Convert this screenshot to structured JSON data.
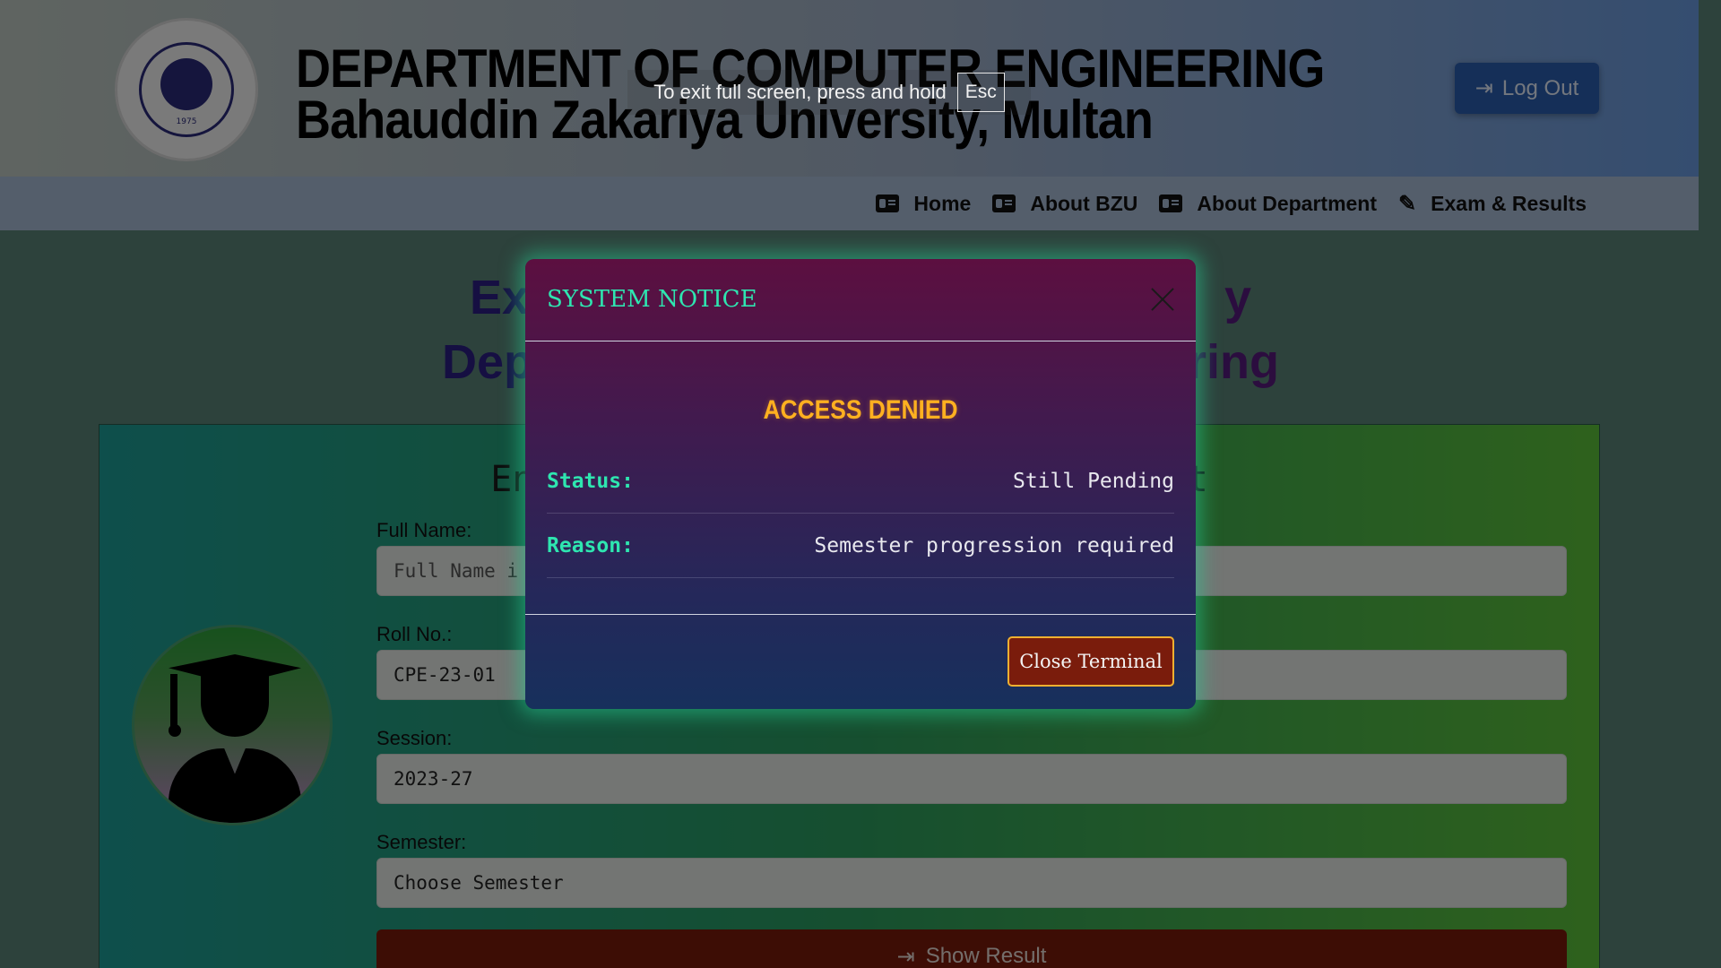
{
  "header": {
    "logo_text": "BAHAUDDIN ZAKARIYA UNIVERSITY MULTAN",
    "logo_year": "1975",
    "title_line1": "DEPARTMENT OF COMPUTER ENGINEERING",
    "title_line2": "Bahauddin Zakariya University, Multan",
    "logout_label": "Log Out"
  },
  "nav": {
    "items": [
      {
        "label": "Home",
        "icon": "id-card-icon"
      },
      {
        "label": "About BZU",
        "icon": "id-card-icon"
      },
      {
        "label": "About Department",
        "icon": "id-card-icon"
      },
      {
        "label": "Exam & Results",
        "icon": "pen-icon"
      }
    ]
  },
  "fullscreen_notice": {
    "text": "To exit full screen, press and hold",
    "key": "Esc"
  },
  "page": {
    "title_line1_left": "Ex",
    "title_line1_right": "y",
    "title_line2_left": "Depa",
    "title_line2_right": "ring",
    "panel_heading_left": "Ent",
    "panel_heading_right": "lt"
  },
  "form": {
    "full_name_label": "Full Name:",
    "full_name_placeholder": "Full Name i",
    "roll_label": "Roll No.:",
    "roll_value": "CPE-23-01",
    "session_label": "Session:",
    "session_value": "2023-27",
    "semester_label": "Semester:",
    "semester_value": "Choose Semester",
    "show_result_label": "Show Result"
  },
  "modal": {
    "title": "SYSTEM NOTICE",
    "headline": "ACCESS DENIED",
    "rows": [
      {
        "key": "Status:",
        "value": "Still Pending"
      },
      {
        "key": "Reason:",
        "value": "Semester progression required"
      }
    ],
    "close_button": "Close Terminal"
  },
  "colors": {
    "modal_accent": "#2ee6b0",
    "headline": "#ffb020",
    "close_button_bg": "#7a1c0c"
  }
}
